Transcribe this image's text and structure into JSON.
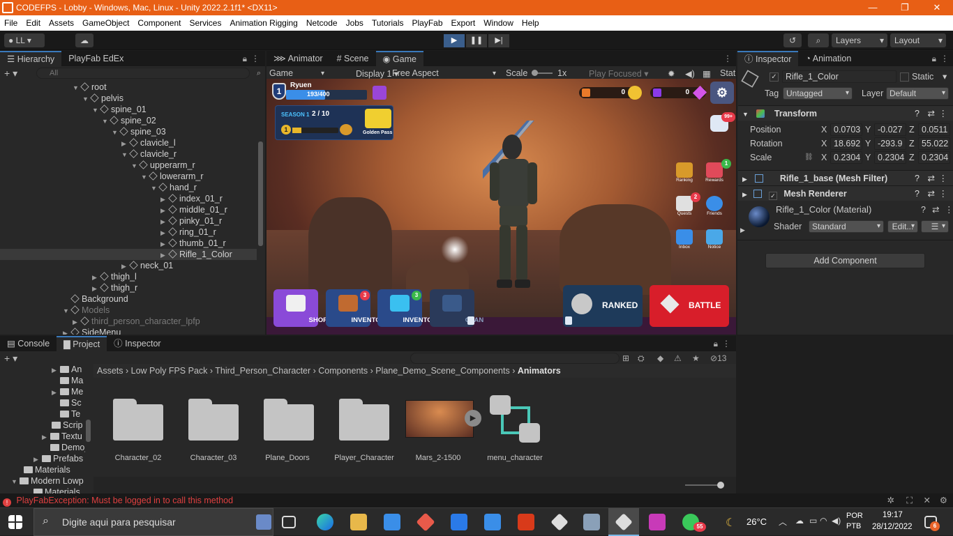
{
  "window": {
    "title": "CODEFPS - Lobby - Windows, Mac, Linux - Unity 2022.2.1f1* <DX11>",
    "controls": [
      "—",
      "❐",
      "✕"
    ]
  },
  "menu": [
    "File",
    "Edit",
    "Assets",
    "GameObject",
    "Component",
    "Services",
    "Animation Rigging",
    "Netcode",
    "Jobs",
    "Tutorials",
    "PlayFab",
    "Export",
    "Window",
    "Help"
  ],
  "toolbar": {
    "account": "LL",
    "layers": "Layers",
    "layout": "Layout"
  },
  "hierarchy": {
    "tabs": [
      "Hierarchy",
      "PlayFab EdEx"
    ],
    "search_placeholder": "All",
    "items": [
      {
        "label": "root",
        "depth": 0
      },
      {
        "label": "pelvis",
        "depth": 1
      },
      {
        "label": "spine_01",
        "depth": 2
      },
      {
        "label": "spine_02",
        "depth": 3
      },
      {
        "label": "spine_03",
        "depth": 4
      },
      {
        "label": "clavicle_l",
        "depth": 5
      },
      {
        "label": "clavicle_r",
        "depth": 5
      },
      {
        "label": "upperarm_r",
        "depth": 6
      },
      {
        "label": "lowerarm_r",
        "depth": 7
      },
      {
        "label": "hand_r",
        "depth": 8
      },
      {
        "label": "index_01_r",
        "depth": 9
      },
      {
        "label": "middle_01_r",
        "depth": 9
      },
      {
        "label": "pinky_01_r",
        "depth": 9
      },
      {
        "label": "ring_01_r",
        "depth": 9
      },
      {
        "label": "thumb_01_r",
        "depth": 9
      },
      {
        "label": "Rifle_1_Color",
        "depth": 9
      },
      {
        "label": "neck_01",
        "depth": 5
      },
      {
        "label": "thigh_l",
        "depth": 2
      },
      {
        "label": "thigh_r",
        "depth": 2
      },
      {
        "label": "Background",
        "depth": -1
      },
      {
        "label": "Models",
        "depth": -1
      },
      {
        "label": "third_person_character_lpfp",
        "depth": 0
      },
      {
        "label": "SideMenu",
        "depth": -1
      }
    ]
  },
  "scene": {
    "tabs": [
      "Animator",
      "Scene",
      "Game"
    ],
    "display_mode": "Game",
    "display": "Display 1",
    "aspect": "Free Aspect",
    "scale_label": "Scale",
    "scale_value": "1x",
    "play_focused": "Play Focused",
    "stats": "Stat"
  },
  "game": {
    "player_name": "Ryuen",
    "level": "1",
    "xp": "193/400",
    "season_label": "SEASON 1",
    "season_progress": "2 / 10",
    "season_level": "1",
    "golden_pass": "Golden Pass",
    "coins": "0",
    "gems": "0",
    "chat_badge": "99+",
    "side": [
      {
        "label": "Ranking",
        "badge": ""
      },
      {
        "label": "Rewards",
        "badge": "1"
      },
      {
        "label": "Quests",
        "badge": "2"
      },
      {
        "label": "Friends",
        "badge": ""
      },
      {
        "label": "Inbox",
        "badge": ""
      },
      {
        "label": "Notice",
        "badge": ""
      }
    ],
    "buttons": [
      {
        "label": "SHOP",
        "badge": ""
      },
      {
        "label": "INVENTORY",
        "badge": "3"
      },
      {
        "label": "INVENTORY",
        "badge": "3"
      },
      {
        "label": "CLAN",
        "badge": ""
      }
    ],
    "ranked": "RANKED",
    "battle": "BATTLE"
  },
  "inspector": {
    "tabs": [
      "Inspector",
      "Animation"
    ],
    "object_name": "Rifle_1_Color",
    "static_label": "Static",
    "tag_label": "Tag",
    "tag_value": "Untagged",
    "layer_label": "Layer",
    "layer_value": "Default",
    "transform": {
      "title": "Transform",
      "position": {
        "label": "Position",
        "x": "0.0703",
        "y": "-0.027",
        "z": "0.0511"
      },
      "rotation": {
        "label": "Rotation",
        "x": "18.692",
        "y": "-293.9",
        "z": "55.022"
      },
      "scale": {
        "label": "Scale",
        "x": "0.2304",
        "y": "0.2304",
        "z": "0.2304"
      }
    },
    "mesh_filter": "Rifle_1_base (Mesh Filter)",
    "mesh_renderer": "Mesh Renderer",
    "material": "Rifle_1_Color (Material)",
    "shader_label": "Shader",
    "shader_value": "Standard",
    "edit": "Edit...",
    "add_component": "Add Component"
  },
  "bottom": {
    "tabs": [
      "Console",
      "Project",
      "Inspector"
    ],
    "hidden_count": "13",
    "breadcrumb": [
      "Assets",
      "Low Poly FPS Pack",
      "Third_Person_Character",
      "Components",
      "Plane_Demo_Scene_Components",
      "Animators"
    ],
    "tree": [
      "An",
      "Ma",
      "Me",
      "Sc",
      "Te",
      "Scrip",
      "Textu",
      "Demo_S",
      "Prefabs",
      "Materials",
      "Modern Lowp",
      "Materials"
    ],
    "assets": [
      "Character_02",
      "Character_03",
      "Plane_Doors",
      "Player_Character",
      "Mars_2-1500",
      "menu_character"
    ]
  },
  "status": {
    "error": "PlayFabException: Must be logged in to call this method"
  },
  "taskbar": {
    "search_placeholder": "Digite aqui para pesquisar",
    "whatsapp_badge": "55",
    "temperature": "26°C",
    "lang1": "POR",
    "lang2": "PTB",
    "time": "19:17",
    "date": "28/12/2022",
    "notif": "6"
  }
}
